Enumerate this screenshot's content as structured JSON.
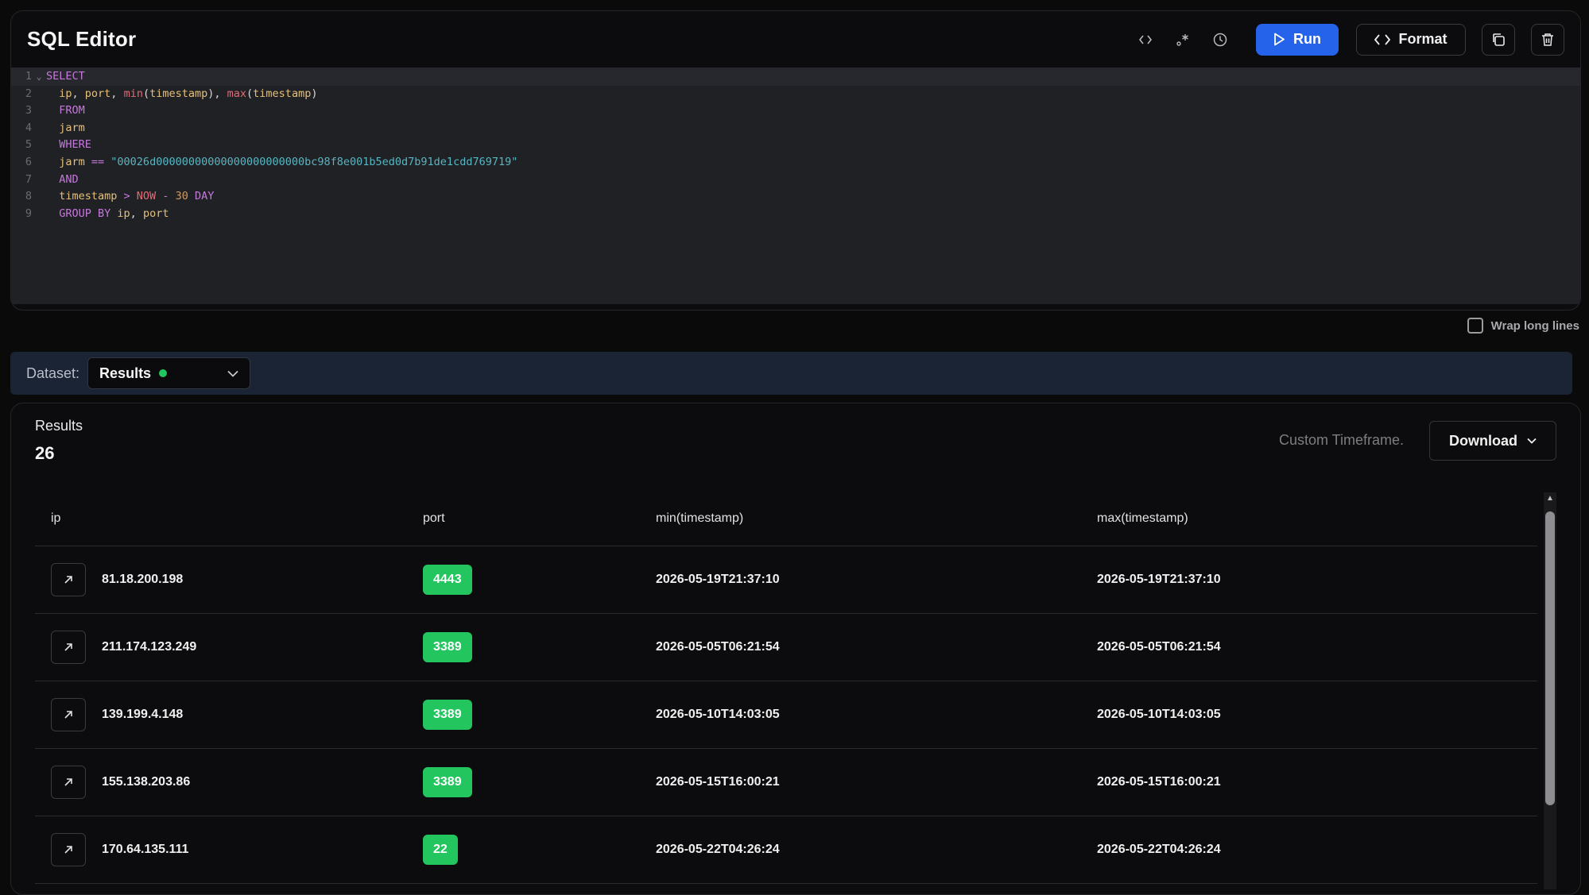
{
  "editor": {
    "title": "SQL Editor",
    "run_label": "Run",
    "format_label": "Format",
    "lines": [
      {
        "n": "1",
        "fold": "⌄",
        "tokens": [
          {
            "t": "SELECT",
            "c": "kw"
          }
        ]
      },
      {
        "n": "2",
        "fold": "",
        "tokens": [
          {
            "t": "  ip",
            "c": "id"
          },
          {
            "t": ", ",
            "c": "plain"
          },
          {
            "t": "port",
            "c": "id"
          },
          {
            "t": ", ",
            "c": "plain"
          },
          {
            "t": "min",
            "c": "fn"
          },
          {
            "t": "(",
            "c": "plain"
          },
          {
            "t": "timestamp",
            "c": "id"
          },
          {
            "t": "), ",
            "c": "plain"
          },
          {
            "t": "max",
            "c": "fn"
          },
          {
            "t": "(",
            "c": "plain"
          },
          {
            "t": "timestamp",
            "c": "id"
          },
          {
            "t": ")",
            "c": "plain"
          }
        ]
      },
      {
        "n": "3",
        "fold": "",
        "tokens": [
          {
            "t": "  FROM",
            "c": "kw"
          }
        ]
      },
      {
        "n": "4",
        "fold": "",
        "tokens": [
          {
            "t": "  jarm",
            "c": "id"
          }
        ]
      },
      {
        "n": "5",
        "fold": "",
        "tokens": [
          {
            "t": "  WHERE",
            "c": "kw"
          }
        ]
      },
      {
        "n": "6",
        "fold": "",
        "tokens": [
          {
            "t": "  jarm",
            "c": "id"
          },
          {
            "t": " == ",
            "c": "op"
          },
          {
            "t": "\"00026d00000000000000000000000bc98f8e001b5ed0d7b91de1cdd769719\"",
            "c": "str"
          }
        ]
      },
      {
        "n": "7",
        "fold": "",
        "tokens": [
          {
            "t": "  AND",
            "c": "kw"
          }
        ]
      },
      {
        "n": "8",
        "fold": "",
        "tokens": [
          {
            "t": "  timestamp",
            "c": "id"
          },
          {
            "t": " > ",
            "c": "op"
          },
          {
            "t": "NOW",
            "c": "fn"
          },
          {
            "t": " - ",
            "c": "op"
          },
          {
            "t": "30",
            "c": "num"
          },
          {
            "t": " DAY",
            "c": "kw"
          }
        ]
      },
      {
        "n": "9",
        "fold": "",
        "tokens": [
          {
            "t": "  GROUP BY ",
            "c": "kw"
          },
          {
            "t": "ip",
            "c": "id"
          },
          {
            "t": ", ",
            "c": "plain"
          },
          {
            "t": "port",
            "c": "id"
          }
        ]
      }
    ]
  },
  "wrap": {
    "label": "Wrap long lines"
  },
  "dataset": {
    "label": "Dataset:",
    "value": "Results"
  },
  "results": {
    "title": "Results",
    "count": "26",
    "timeframe": "Custom Timeframe.",
    "download_label": "Download",
    "columns": [
      "ip",
      "port",
      "min(timestamp)",
      "max(timestamp)"
    ],
    "rows": [
      {
        "ip": "81.18.200.198",
        "port": "4443",
        "min": "2026-05-19T21:37:10",
        "max": "2026-05-19T21:37:10"
      },
      {
        "ip": "211.174.123.249",
        "port": "3389",
        "min": "2026-05-05T06:21:54",
        "max": "2026-05-05T06:21:54"
      },
      {
        "ip": "139.199.4.148",
        "port": "3389",
        "min": "2026-05-10T14:03:05",
        "max": "2026-05-10T14:03:05"
      },
      {
        "ip": "155.138.203.86",
        "port": "3389",
        "min": "2026-05-15T16:00:21",
        "max": "2026-05-15T16:00:21"
      },
      {
        "ip": "170.64.135.111",
        "port": "22",
        "min": "2026-05-22T04:26:24",
        "max": "2026-05-22T04:26:24"
      }
    ]
  },
  "colors": {
    "accent": "#2563eb",
    "port_badge": "#22c55e",
    "status_dot": "#22c55e"
  }
}
